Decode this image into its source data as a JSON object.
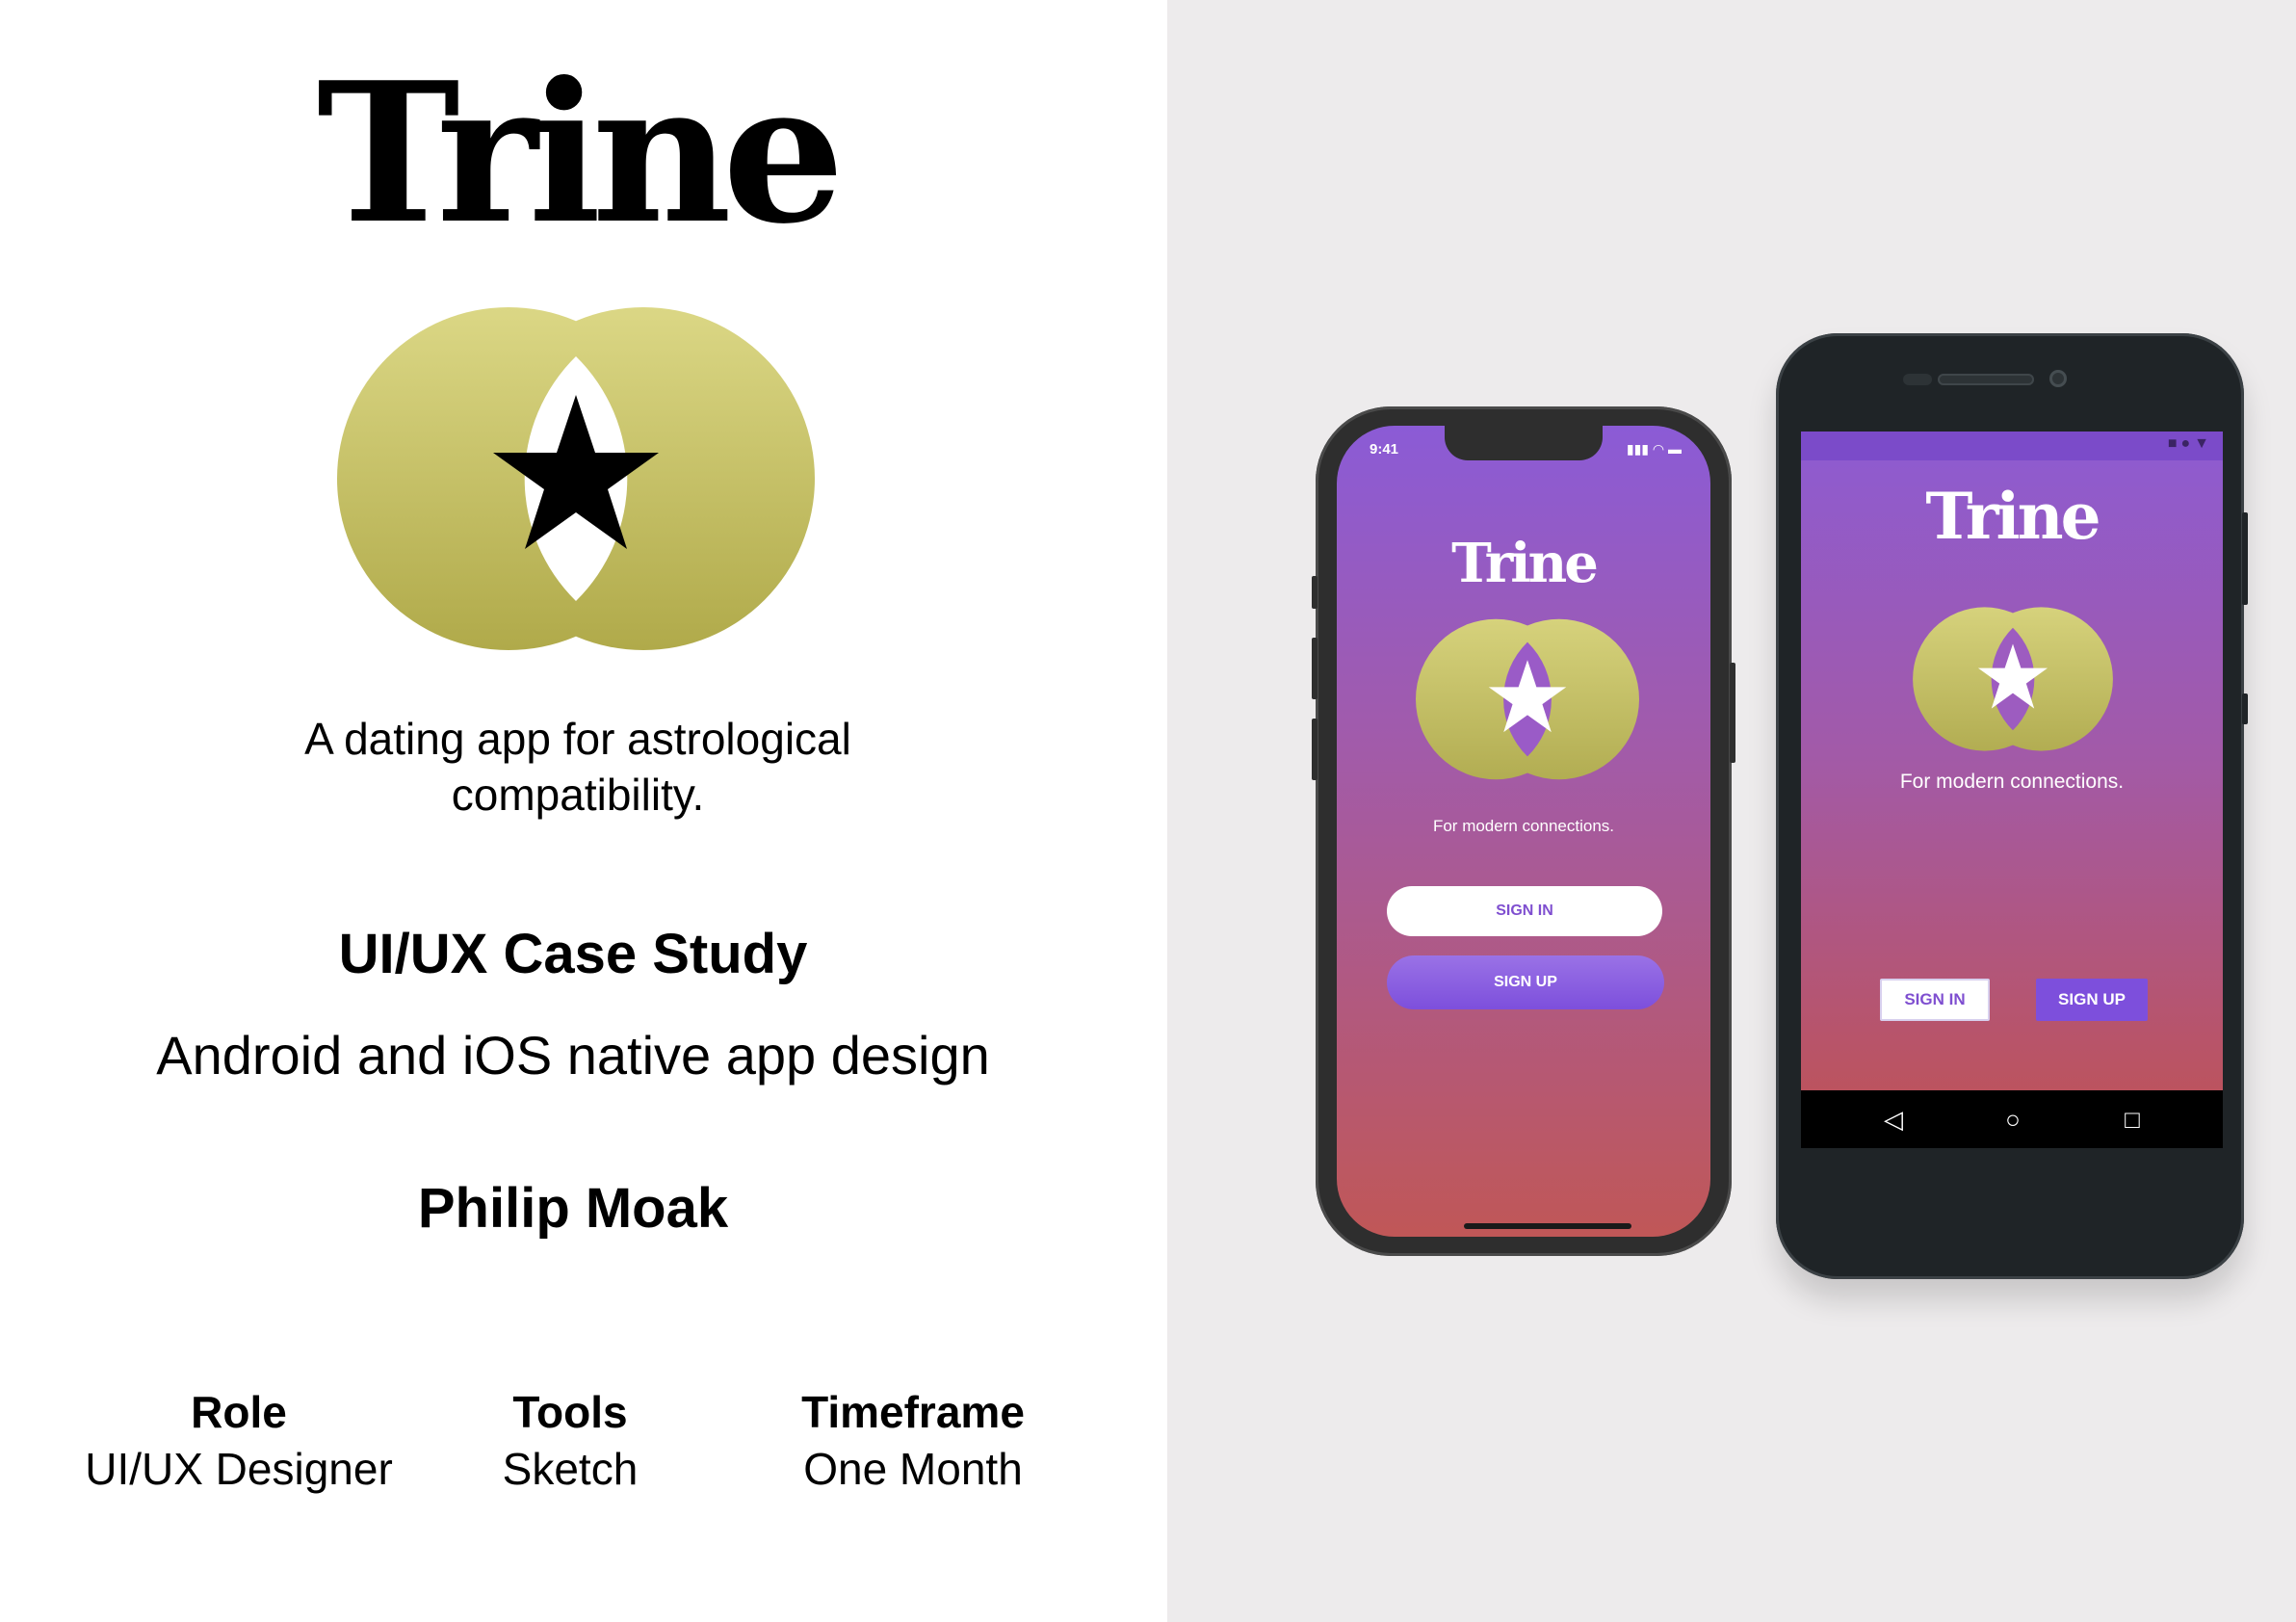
{
  "brand": {
    "name": "Trine",
    "logo_icon": "venn-star-logo",
    "gold": "#c7c363",
    "purple": "#8b5bd6",
    "red": "#c05252"
  },
  "intro": {
    "tagline": "A dating app for astrological compatibility.",
    "case_title": "UI/UX Case Study",
    "case_subtitle": "Android and iOS native app design",
    "author": "Philip Moak"
  },
  "meta": [
    {
      "key": "Role",
      "value": "UI/UX Designer"
    },
    {
      "key": "Tools",
      "value": "Sketch"
    },
    {
      "key": "Timeframe",
      "value": "One Month"
    }
  ],
  "ios": {
    "time": "9:41",
    "title": "Trine",
    "tagline": "For modern connections.",
    "sign_in": "SIGN IN",
    "sign_up": "SIGN UP"
  },
  "android": {
    "title": "Trine",
    "tagline": "For modern connections.",
    "sign_in": "SIGN IN",
    "sign_up": "SIGN UP",
    "nav_back": "◁",
    "nav_home": "○",
    "nav_recent": "□"
  }
}
